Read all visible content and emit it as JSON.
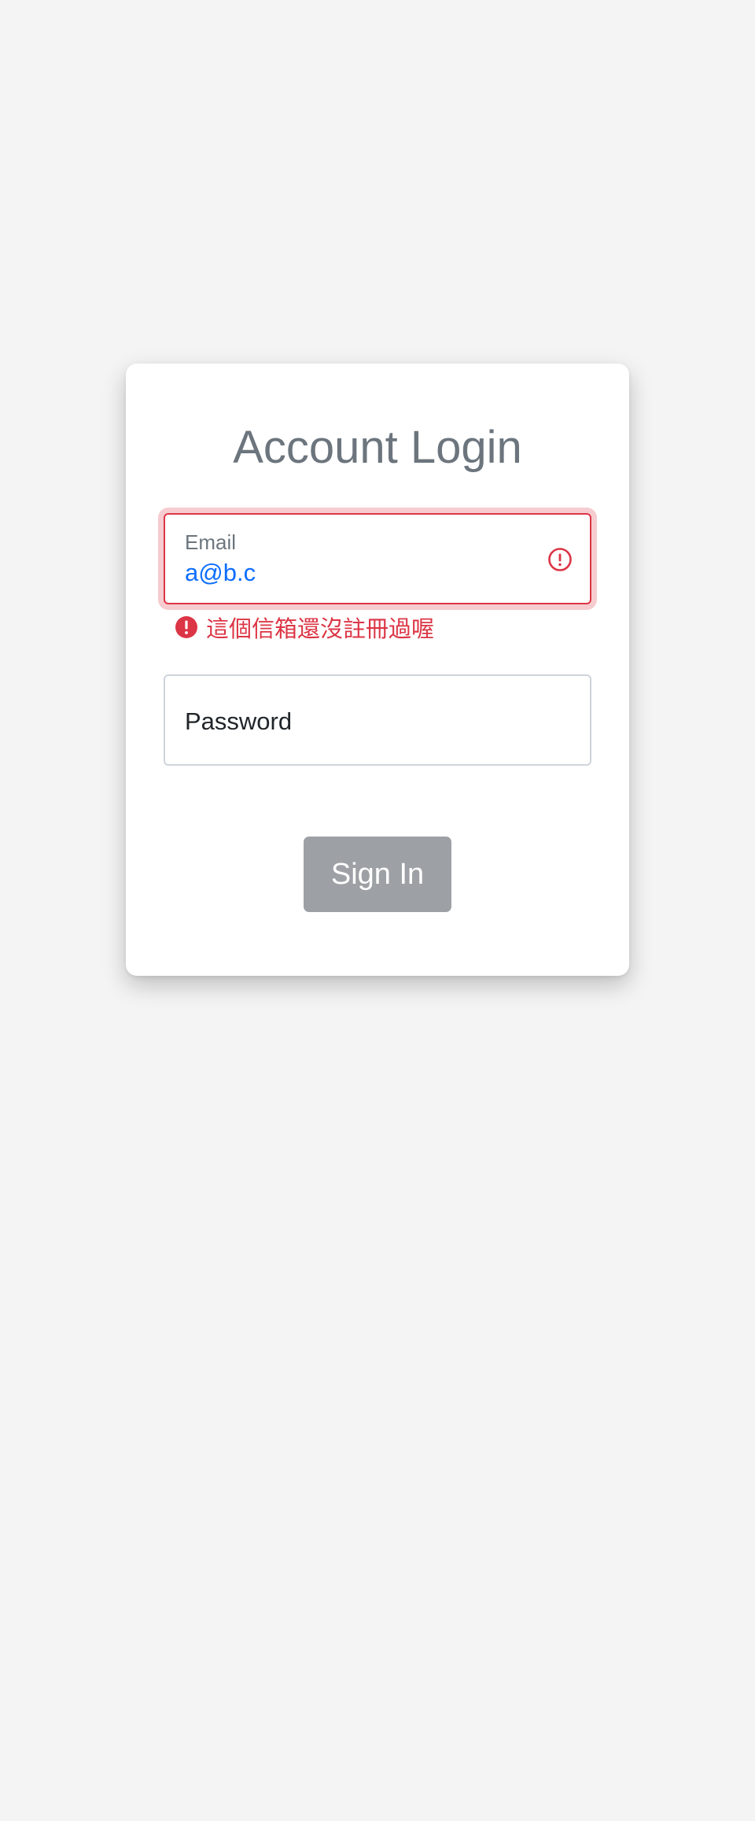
{
  "login": {
    "title": "Account Login",
    "email": {
      "label": "Email",
      "value": "a@b.c",
      "state": "invalid",
      "icon": "alert-circle-icon",
      "error_message": "這個信箱還沒註冊過喔"
    },
    "password": {
      "placeholder": "Password",
      "value": ""
    },
    "submit_label": "Sign In"
  },
  "colors": {
    "background": "#f4f4f4",
    "card": "#ffffff",
    "title": "#6c757d",
    "error": "#dc3545",
    "email_value": "#0d6efd",
    "button": "#9da1a5"
  }
}
